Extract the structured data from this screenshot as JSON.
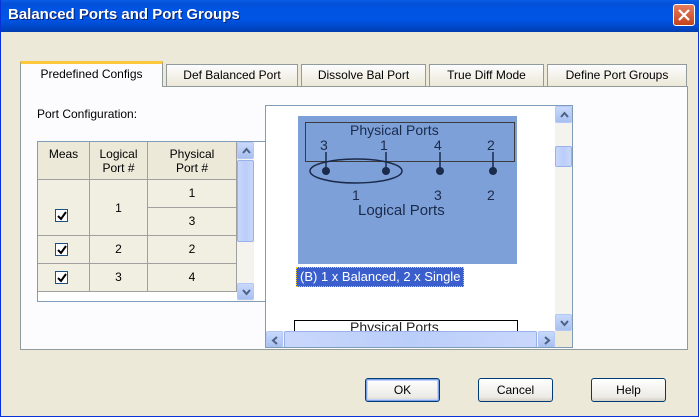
{
  "window": {
    "title": "Balanced Ports and Port Groups"
  },
  "tabs": [
    {
      "label": "Predefined Configs",
      "active": true
    },
    {
      "label": "Def Balanced Port",
      "active": false
    },
    {
      "label": "Dissolve Bal Port",
      "active": false
    },
    {
      "label": "True Diff Mode",
      "active": false
    },
    {
      "label": "Define Port Groups",
      "active": false
    }
  ],
  "port_config": {
    "label": "Port Configuration:",
    "columns": {
      "meas": "Meas",
      "logical_1": "Logical",
      "logical_2": "Port #",
      "physical_1": "Physical",
      "physical_2": "Port #"
    },
    "rows": [
      {
        "meas": true,
        "logical": "1",
        "physical": [
          "1",
          "3"
        ]
      },
      {
        "meas": true,
        "logical": "2",
        "physical": [
          "2"
        ]
      },
      {
        "meas": true,
        "logical": "3",
        "physical": [
          "4"
        ]
      }
    ]
  },
  "preview": {
    "physical_label": "Physical Ports",
    "physical_ports": [
      "3",
      "1",
      "4",
      "2"
    ],
    "logical_ports": [
      "1",
      "3",
      "2"
    ],
    "logical_label": "Logical Ports",
    "selected_caption": "(B)  1 x Balanced, 2 x Single",
    "next_item_label": "Physical Ports"
  },
  "buttons": {
    "ok": "OK",
    "cancel": "Cancel",
    "help": "Help"
  },
  "colors": {
    "titlebar": "#0054e3",
    "selection": "#3a5fcd",
    "diagram_bg": "#7ea0d8",
    "active_tab_accent": "#ffc83c"
  }
}
